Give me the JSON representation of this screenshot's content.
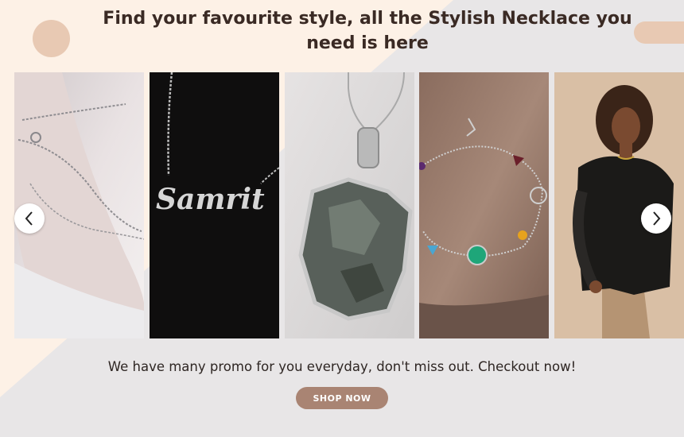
{
  "header": {
    "title": "Find your favourite style, all the Stylish Necklace you need is here"
  },
  "gallery": {
    "items": [
      {
        "name": "silver-anklet-photo",
        "alt": ""
      },
      {
        "name": "name-necklace-photo",
        "engraved_text": "Samrit"
      },
      {
        "name": "green-stone-pendant-photo",
        "alt": ""
      },
      {
        "name": "gemstone-bracelet-photo",
        "alt": ""
      },
      {
        "name": "model-wearing-necklace-photo",
        "alt": ""
      }
    ],
    "prev_icon": "chevron-left-icon",
    "next_icon": "chevron-right-icon"
  },
  "promo": {
    "text": "We have many promo for you everyday, don't miss out. Checkout now!"
  },
  "cta": {
    "label": "SHOP NOW"
  },
  "colors": {
    "cream": "#fdf1e6",
    "grey": "#e8e6e7",
    "accent": "#e8c9b3",
    "button": "#a98473",
    "text": "#3a2a24"
  }
}
